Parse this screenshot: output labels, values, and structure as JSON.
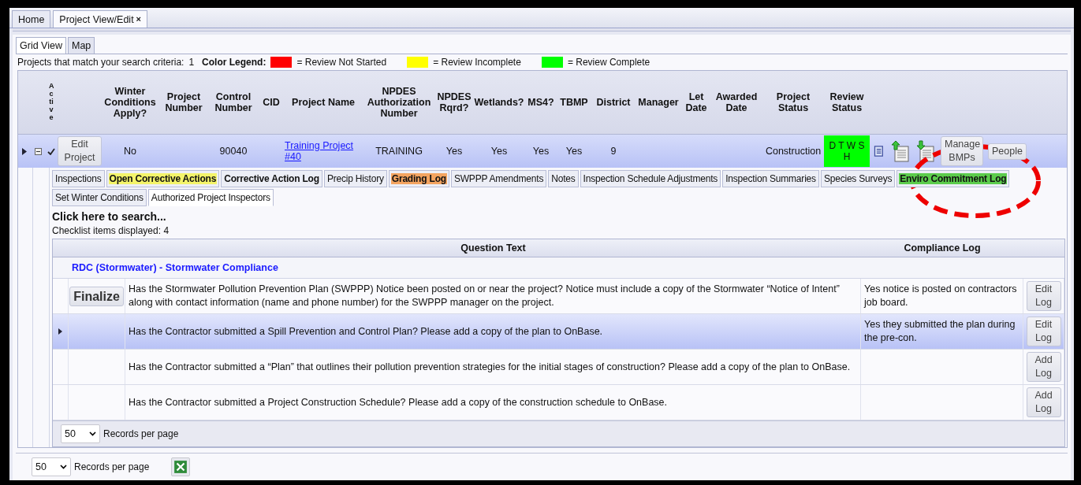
{
  "top_tabs": [
    {
      "label": "Home",
      "selected": false
    },
    {
      "label": "Project View/Edit",
      "selected": true,
      "close": "×"
    }
  ],
  "view_tabs": [
    {
      "label": "Grid View",
      "selected": true
    },
    {
      "label": "Map",
      "selected": false
    }
  ],
  "summary": {
    "label": "Projects that match your search criteria:",
    "count": "1"
  },
  "legend": {
    "label": "Color Legend:",
    "items": [
      {
        "color": "#ff0000",
        "text": "= Review Not Started"
      },
      {
        "color": "#ffff00",
        "text": "= Review Incomplete"
      },
      {
        "color": "#00ff00",
        "text": "= Review Complete"
      }
    ]
  },
  "columns": [
    {
      "kind": "blank"
    },
    {
      "kind": "blank"
    },
    {
      "kind": "vertical",
      "label": "Active"
    },
    {
      "kind": "blank"
    },
    {
      "kind": "text",
      "label": "Winter Conditions Apply?"
    },
    {
      "kind": "text",
      "label": "Project Number"
    },
    {
      "kind": "text",
      "label": "Control Number"
    },
    {
      "kind": "text",
      "label": "CID"
    },
    {
      "kind": "text",
      "label": "Project Name"
    },
    {
      "kind": "text",
      "label": "NPDES Authorization Number"
    },
    {
      "kind": "text",
      "label": "NPDES Rqrd?"
    },
    {
      "kind": "text",
      "label": "Wetlands?"
    },
    {
      "kind": "text",
      "label": "MS4?"
    },
    {
      "kind": "text",
      "label": "TBMP"
    },
    {
      "kind": "text",
      "label": "District"
    },
    {
      "kind": "text",
      "label": "Manager"
    },
    {
      "kind": "text",
      "label": "Let Date"
    },
    {
      "kind": "text",
      "label": "Awarded Date"
    },
    {
      "kind": "text",
      "label": "Project Status"
    },
    {
      "kind": "text",
      "label": "Review Status"
    },
    {
      "kind": "blank"
    }
  ],
  "project": {
    "expanded": true,
    "active": true,
    "edit_button": "Edit Project",
    "winter": "No",
    "control_number": "90040",
    "project_name": "Training Project #40",
    "npdes_number": "TRAINING",
    "npdes_rqrd": "Yes",
    "wetlands": "Yes",
    "ms4": "Yes",
    "tbmp": "Yes",
    "district": "9",
    "project_status": "Construction",
    "review_status": {
      "text": "D T W S H",
      "color": "#00ff00"
    },
    "buttons": [
      "Manage BMPs",
      "People"
    ]
  },
  "detail_tabs": [
    {
      "label": "Inspections",
      "bold": false,
      "selected": false
    },
    {
      "label": "Open Corrective Actions",
      "bold": true,
      "color": "#f4f46a",
      "selected": false
    },
    {
      "label": "Corrective Action Log",
      "bold": true,
      "selected": false
    },
    {
      "label": "Precip History",
      "bold": false,
      "selected": false
    },
    {
      "label": "Grading Log",
      "bold": true,
      "color": "#f4a460",
      "selected": false
    },
    {
      "label": "SWPPP Amendments",
      "bold": false,
      "selected": false
    },
    {
      "label": "Notes",
      "bold": false,
      "selected": false
    },
    {
      "label": "Inspection Schedule Adjustments",
      "bold": false,
      "selected": false
    },
    {
      "label": "Inspection Summaries",
      "bold": false,
      "selected": false
    },
    {
      "label": "Species Surveys",
      "bold": false,
      "selected": false
    },
    {
      "label": "Enviro Commitment Log",
      "bold": true,
      "color": "#5ccc4c",
      "selected": false
    },
    {
      "label": "Set Winter Conditions",
      "bold": false,
      "selected": false
    },
    {
      "label": "Authorized Project Inspectors",
      "bold": false,
      "selected": true
    }
  ],
  "checklist": {
    "search": "Click here to search...",
    "count_label": "Checklist items displayed:",
    "count": "4",
    "columns": [
      "Question Text",
      "Compliance Log"
    ],
    "group": "RDC (Stormwater) - Stormwater Compliance",
    "rows": [
      {
        "selected": false,
        "finalize": "Finalize",
        "question": "Has the Stormwater Pollution Prevention Plan (SWPPP) Notice been posted on or near the project? Notice must include a copy of the Stormwater “Notice of Intent” along with contact information (name and phone number) for the SWPPP manager on the project.",
        "log": "Yes notice is posted on contractors job board.",
        "action": "Edit Log"
      },
      {
        "selected": true,
        "question": "Has the Contractor submitted a Spill Prevention and Control Plan? Please add a copy of the plan to OnBase.",
        "log": "Yes they submitted the plan during the pre-con.",
        "action": "Edit Log"
      },
      {
        "selected": false,
        "question": "Has the Contractor submitted a “Plan” that outlines their pollution prevention strategies for the initial stages of construction? Please add a copy of the plan to OnBase.",
        "action": "Add Log"
      },
      {
        "selected": false,
        "question": "Has the Contractor submitted a Project Construction Schedule? Please add a copy of the construction schedule to OnBase.",
        "action": "Add Log"
      }
    ],
    "page_size": "50",
    "page_size_label": "Records per page"
  },
  "footer": {
    "page_size": "50",
    "page_size_label": "Records per page"
  }
}
